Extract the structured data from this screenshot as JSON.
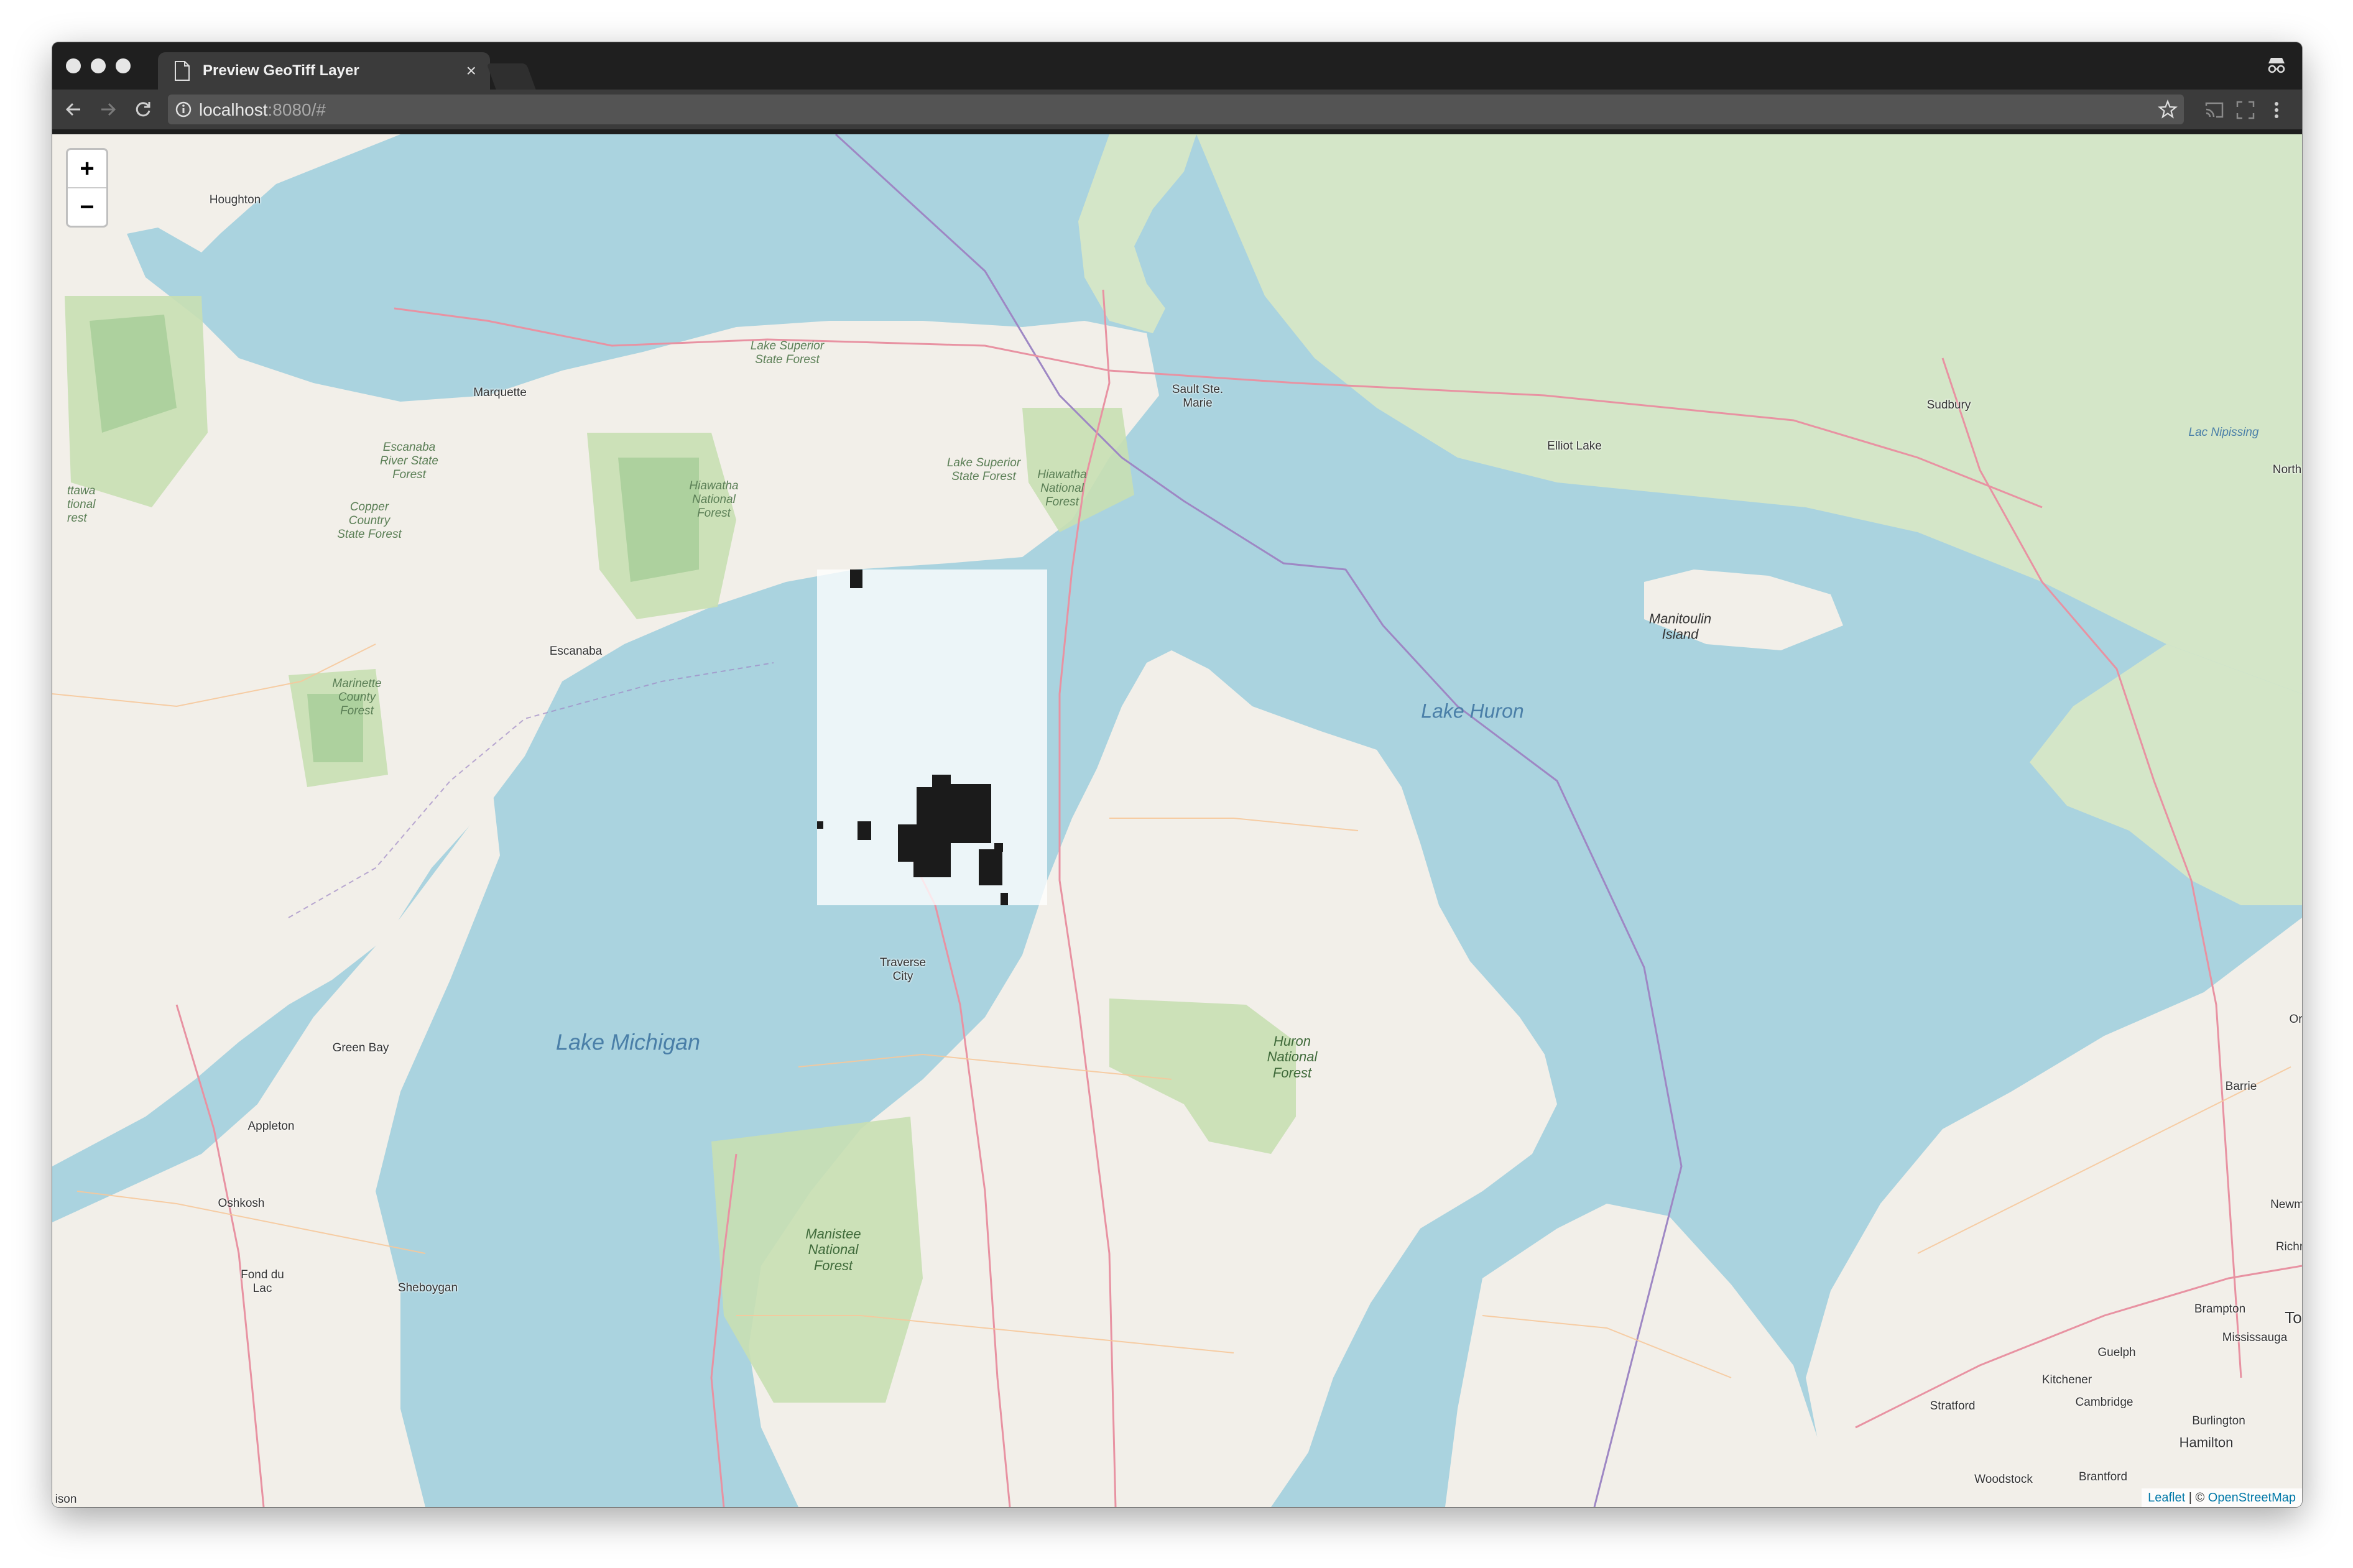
{
  "browser": {
    "tab_title": "Preview GeoTiff Layer",
    "tab_close": "×",
    "url_host": "localhost",
    "url_rest": ":8080/#"
  },
  "map": {
    "zoom_in": "+",
    "zoom_out": "−",
    "attribution": {
      "leaflet": "Leaflet",
      "separator": " | © ",
      "osm": "OpenStreetMap"
    },
    "labels": {
      "lake_michigan": "Lake Michigan",
      "lake_huron": "Lake Huron",
      "manitoulin_island": [
        "Manitoulin",
        "Island"
      ],
      "houghton": "Houghton",
      "marquette": "Marquette",
      "escanaba": "Escanaba",
      "green_bay": "Green Bay",
      "appleton": "Appleton",
      "oshkosh": "Oshkosh",
      "fond_du_lac": [
        "Fond du",
        "Lac"
      ],
      "sheboygan": "Sheboygan",
      "traverse_city": [
        "Traverse",
        "City"
      ],
      "sault_ste_marie": [
        "Sault Ste.",
        "Marie"
      ],
      "sudbury": "Sudbury",
      "elliot_lake": "Elliot Lake",
      "barrie": "Barrie",
      "brampton": "Brampton",
      "mississauga": "Mississauga",
      "kitchener": "Kitchener",
      "guelph": "Guelph",
      "cambridge": "Cambridge",
      "burlington": "Burlington",
      "hamilton": "Hamilton",
      "stratford": "Stratford",
      "woodstock": "Woodstock",
      "brantford": "Brantford",
      "newm": "Newm",
      "richr": "Richr",
      "north": "North",
      "to": "To",
      "or": "Or",
      "ison": "ison",
      "lake_superior_sf_1": [
        "Lake Superior",
        "State Forest"
      ],
      "lake_superior_sf_2": [
        "Lake Superior",
        "State Forest"
      ],
      "escanaba_river_sf": [
        "Escanaba",
        "River State",
        "Forest"
      ],
      "copper_country_sf": [
        "Copper",
        "Country",
        "State Forest"
      ],
      "hiawatha_nf_west": [
        "Hiawatha",
        "National",
        "Forest"
      ],
      "hiawatha_nf_east": [
        "Hiawatha",
        "National",
        "Forest"
      ],
      "marinette_cf": [
        "Marinette",
        "County",
        "Forest"
      ],
      "ottawa_nf": [
        "ttawa",
        "tional",
        "rest"
      ],
      "lac_nipissing": "Lac Nipissing",
      "huron_nf": [
        "Huron",
        "National",
        "Forest"
      ],
      "manistee_nf": [
        "Manistee",
        "National",
        "Forest"
      ]
    }
  },
  "colors": {
    "water": "#aad3df",
    "land": "#f2efe9",
    "forest": "#c8dfb2",
    "park": "#add19e",
    "border": "#9e87c4",
    "highway": "#e892a2",
    "road": "#f6c89b",
    "geotiff_overlay": "#ffffff",
    "geotiff_pixels": "#1b1b1b"
  }
}
